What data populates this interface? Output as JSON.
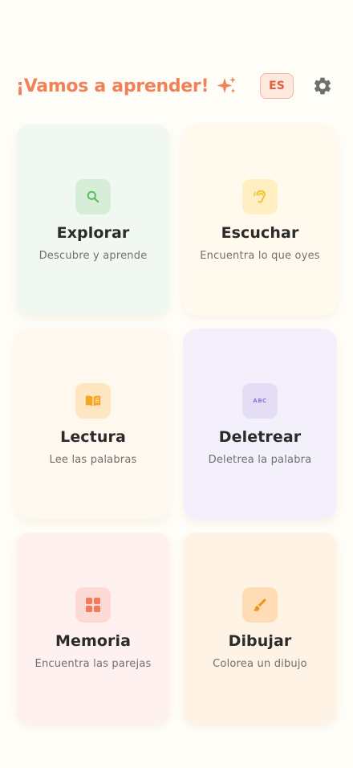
{
  "header": {
    "title": "¡Vamos a aprender!",
    "language_label": "ES",
    "sparkle_icon": "sparkles-icon",
    "settings_icon": "gear-icon"
  },
  "cards": [
    {
      "id": "explorar",
      "title": "Explorar",
      "subtitle": "Descubre y aprende",
      "icon": "search-icon",
      "background": "#F1F8F1",
      "icon_background": "#D6EED7",
      "icon_color": "#5DBB63"
    },
    {
      "id": "escuchar",
      "title": "Escuchar",
      "subtitle": "Encuentra lo que oyes",
      "icon": "ear-icon",
      "background": "#FFFAED",
      "icon_background": "#FFEFC2",
      "icon_color": "#F2C23A"
    },
    {
      "id": "lectura",
      "title": "Lectura",
      "subtitle": "Lee las palabras",
      "icon": "book-icon",
      "background": "#FFF8EE",
      "icon_background": "#FFE6C2",
      "icon_color": "#F5A623"
    },
    {
      "id": "deletrear",
      "title": "Deletrear",
      "subtitle": "Deletrea la palabra",
      "icon": "abc-icon",
      "icon_text": "ABC",
      "background": "#F3F0FB",
      "icon_background": "#E3DDF6",
      "icon_color": "#8E78D6"
    },
    {
      "id": "memoria",
      "title": "Memoria",
      "subtitle": "Encuentra las parejas",
      "icon": "grid-icon",
      "background": "#FFF1EF",
      "icon_background": "#FDDAD3",
      "icon_color": "#EF7A5E"
    },
    {
      "id": "dibujar",
      "title": "Dibujar",
      "subtitle": "Colorea un dibujo",
      "icon": "brush-icon",
      "background": "#FFF3E5",
      "icon_background": "#FFDDB4",
      "icon_color": "#F0931D"
    }
  ]
}
